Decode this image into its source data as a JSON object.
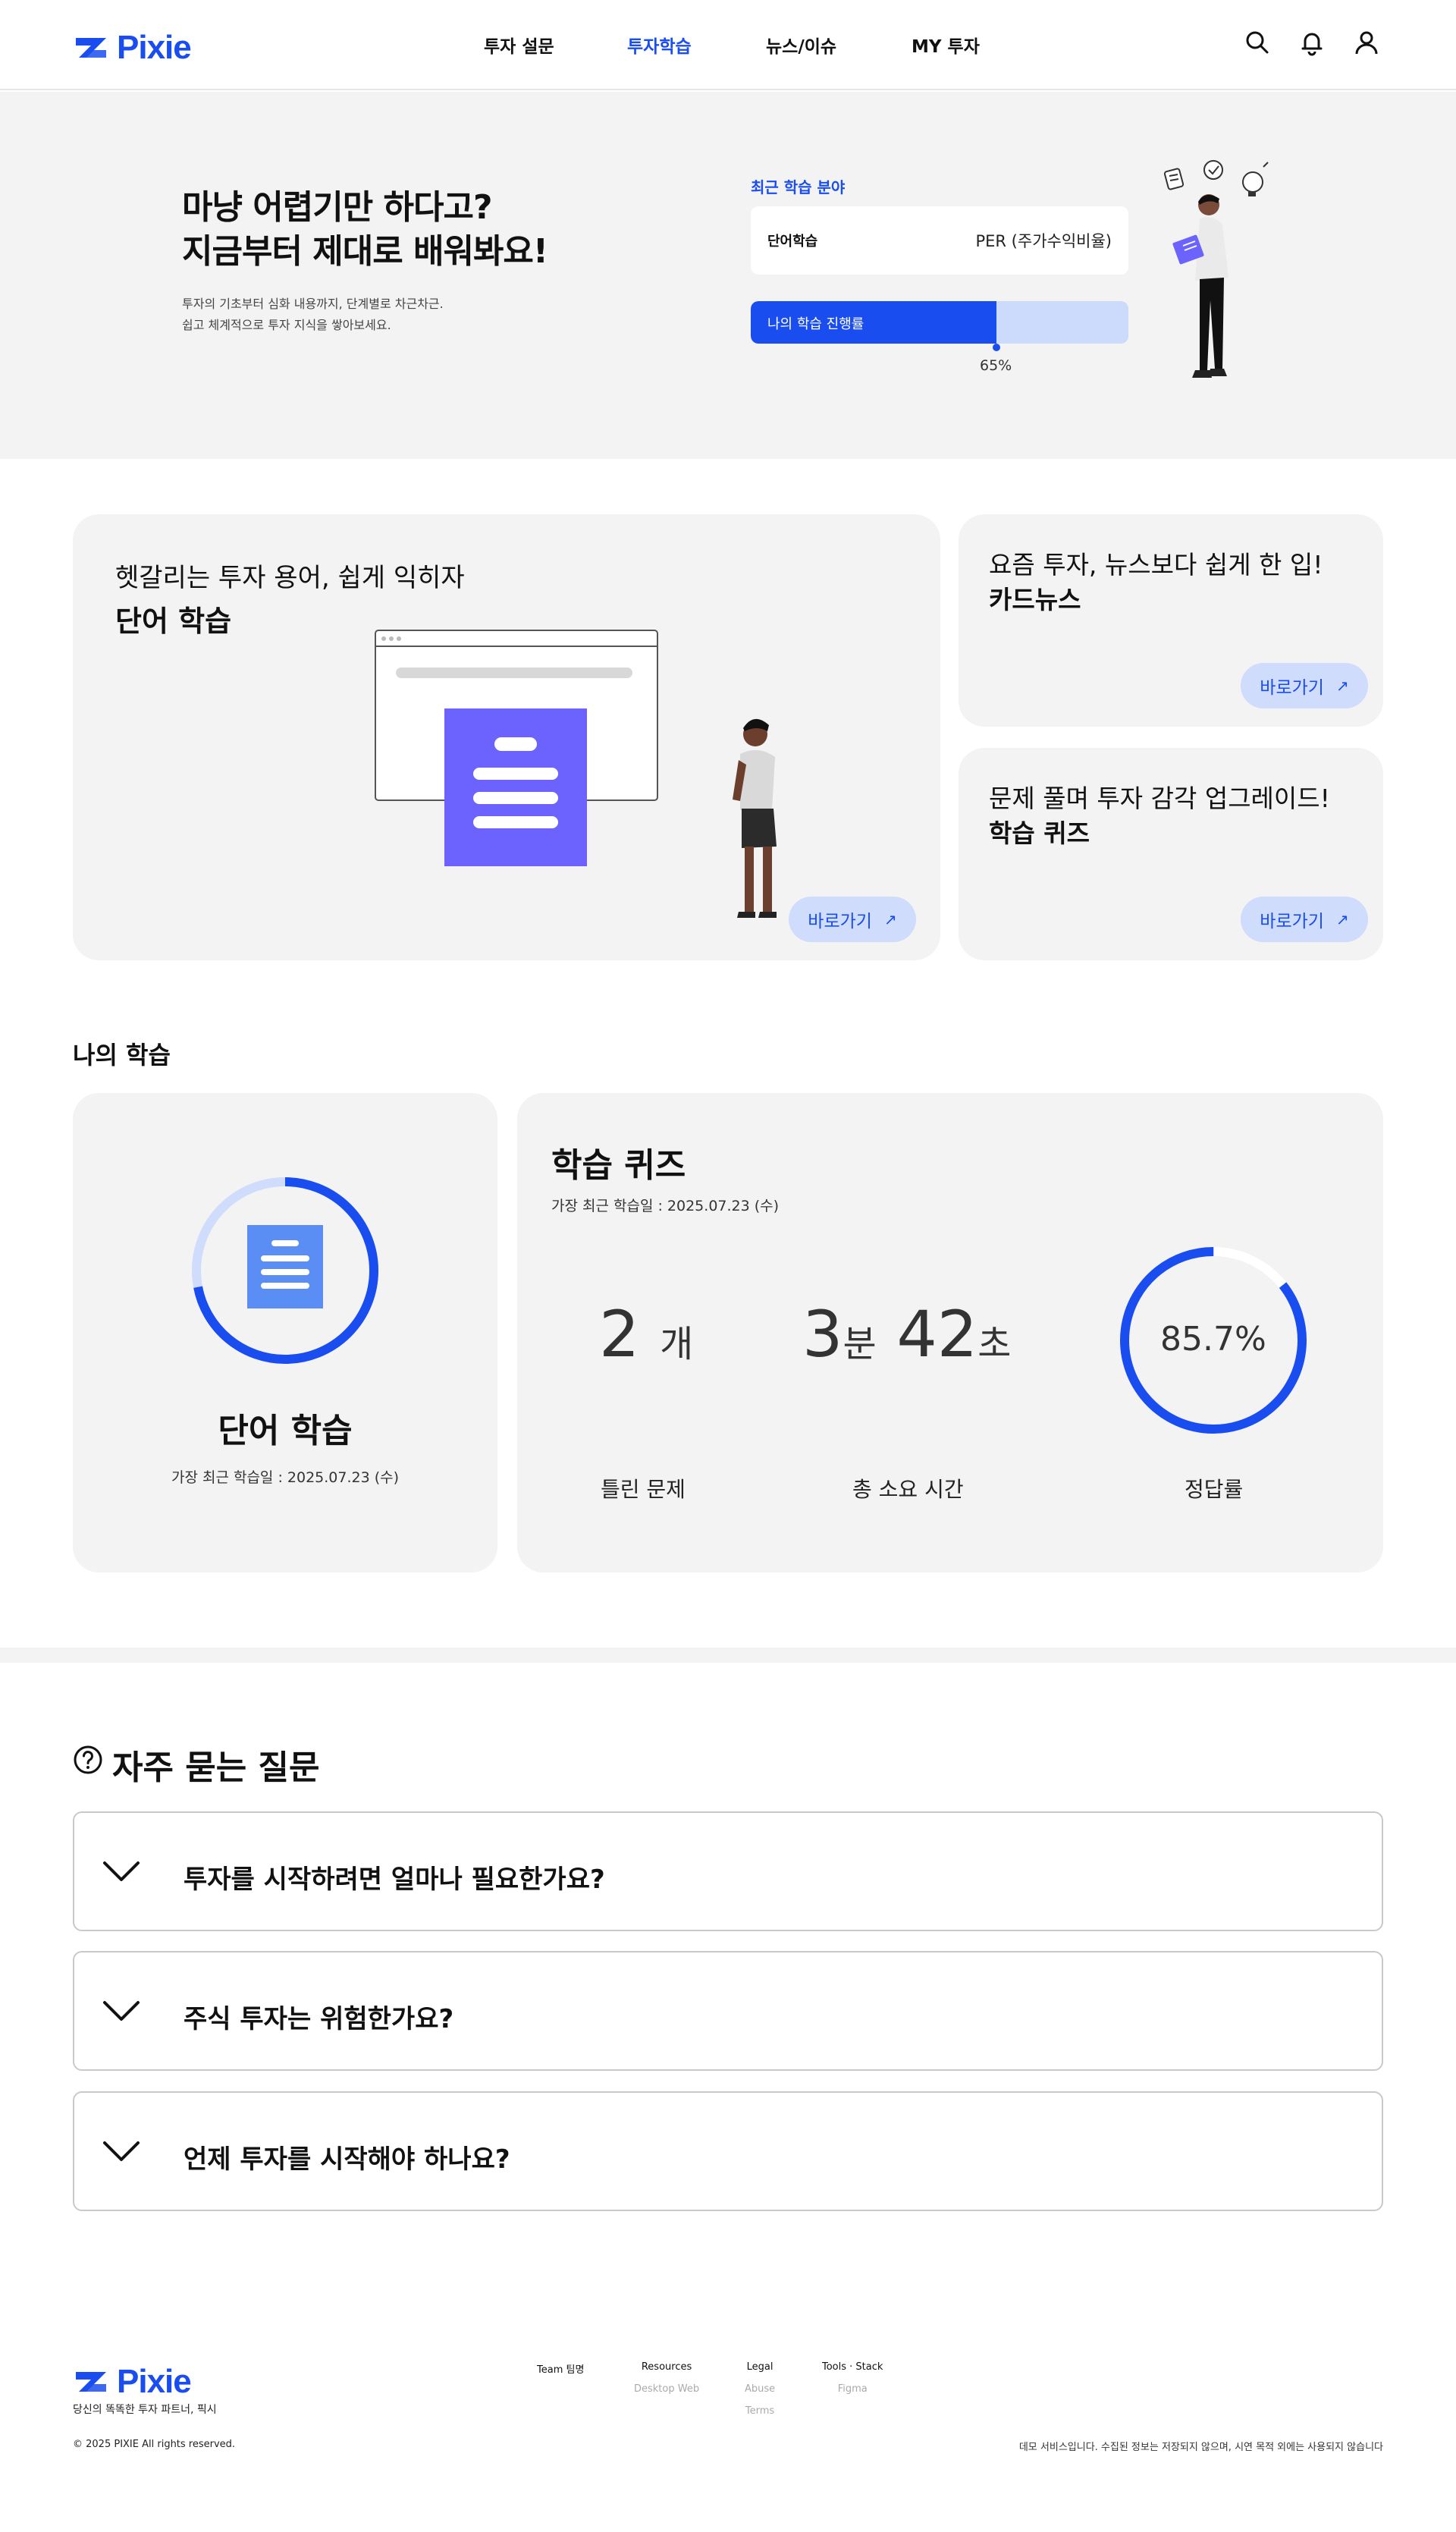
{
  "header": {
    "logo": "Pixie",
    "nav": [
      {
        "label": "투자 설문",
        "active": false
      },
      {
        "label": "투자학습",
        "active": true
      },
      {
        "label": "뉴스/이슈",
        "active": false
      },
      {
        "label": "MY 투자",
        "active": false
      }
    ],
    "icons": [
      "search-icon",
      "bell-icon",
      "user-icon"
    ]
  },
  "hero": {
    "title_line1": "마냥 어렵기만 하다고?",
    "title_line2": "지금부터 제대로 배워봐요!",
    "desc_line1": "투자의 기초부터 심화 내용까지, 단계별로 차근차근.",
    "desc_line2": "쉽고 체계적으로 투자 지식을 쌓아보세요.",
    "recent_label": "최근 학습 분야",
    "recent_key": "단어학습",
    "recent_value": "PER (주가수익비율)",
    "progress_label": "나의 학습 진행률",
    "progress_value": 65,
    "progress_text": "65%"
  },
  "cards": {
    "vocab": {
      "sub": "헷갈리는 투자 용어, 쉽게 익히자",
      "title": "단어 학습",
      "button": "바로가기"
    },
    "news": {
      "sub": "요즘 투자, 뉴스보다 쉽게 한 입!",
      "title": "카드뉴스",
      "button": "바로가기"
    },
    "quiz": {
      "sub": "문제 풀며 투자 감각 업그레이드!",
      "title": "학습 퀴즈",
      "button": "바로가기"
    }
  },
  "my_learning": {
    "section_title": "나의 학습",
    "words": {
      "title": "단어 학습",
      "date": "가장 최근 학습일 : 2025.07.23 (수)",
      "progress": 0.72
    },
    "quiz": {
      "title": "학습 퀴즈",
      "date": "가장 최근 학습일 : 2025.07.23 (수)",
      "wrong_num": "2",
      "wrong_unit": "개",
      "wrong_label": "틀린 문제",
      "time_min": "3",
      "time_min_unit": "분",
      "time_sec": "42",
      "time_sec_unit": "초",
      "time_label": "총 소요 시간",
      "accuracy_text": "85.7%",
      "accuracy_value": 85.7,
      "accuracy_label": "정답률"
    }
  },
  "faq": {
    "title": "자주 묻는 질문",
    "items": [
      {
        "q": "투자를 시작하려면 얼마나 필요한가요?"
      },
      {
        "q": "주식 투자는 위험한가요?"
      },
      {
        "q": "언제 투자를 시작해야 하나요?"
      }
    ]
  },
  "footer": {
    "logo": "Pixie",
    "tagline": "당신의 똑똑한 투자 파트너, 픽시",
    "copyright": "© 2025 PIXIE All rights reserved.",
    "columns": [
      {
        "heading": "Team 팀명",
        "links": []
      },
      {
        "heading": "Resources",
        "links": [
          "Desktop Web"
        ]
      },
      {
        "heading": "Legal",
        "links": [
          "Abuse",
          "Terms"
        ]
      },
      {
        "heading": "Tools · Stack",
        "links": [
          "Figma"
        ]
      }
    ],
    "notice": "데모 서비스입니다. 수집된 정보는 저장되지 않으며, 시연 목적 외에는 사용되지 않습니다"
  },
  "colors": {
    "accent": "#1a4df0",
    "accent_light": "#cfdcfc",
    "card_bg": "#f3f3f3",
    "violet": "#6c63ff"
  }
}
